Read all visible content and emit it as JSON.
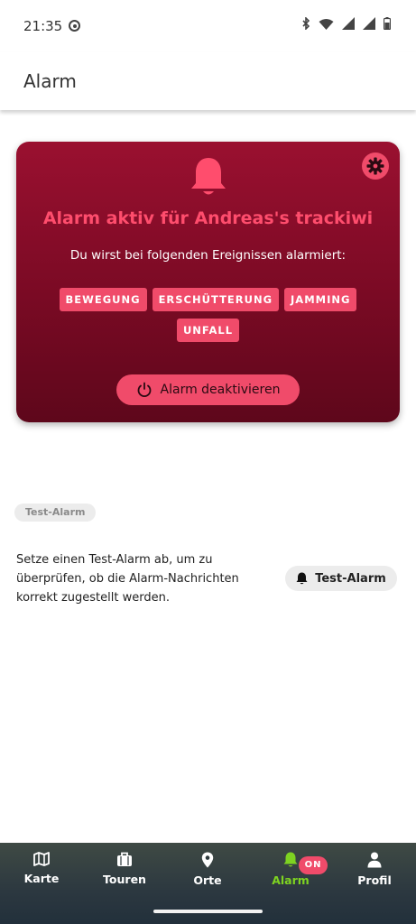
{
  "status_bar": {
    "time": "21:35"
  },
  "header": {
    "title": "Alarm"
  },
  "alarm_card": {
    "title": "Alarm aktiv für Andreas's trackiwi",
    "subtitle": "Du wirst bei folgenden Ereignissen alarmiert:",
    "tags": [
      "BEWEGUNG",
      "ERSCHÜTTERUNG",
      "JAMMING",
      "UNFALL"
    ],
    "deactivate_label": "Alarm deaktivieren"
  },
  "test_section": {
    "chip_label": "Test-Alarm",
    "description": "Setze einen Test-Alarm ab, um zu überprüfen, ob die Alarm-Nachrichten korrekt zugestellt werden.",
    "button_label": "Test-Alarm"
  },
  "bottom_nav": {
    "items": [
      {
        "label": "Karte",
        "icon": "map-icon"
      },
      {
        "label": "Touren",
        "icon": "briefcase-icon"
      },
      {
        "label": "Orte",
        "icon": "location-pin-icon"
      },
      {
        "label": "Alarm",
        "icon": "bell-icon",
        "active": true
      },
      {
        "label": "Profil",
        "icon": "person-icon"
      }
    ],
    "alarm_badge": "ON"
  },
  "colors": {
    "accent": "#f04b6a",
    "card_dark": "#7a0a24",
    "active_nav": "#7ed321"
  }
}
